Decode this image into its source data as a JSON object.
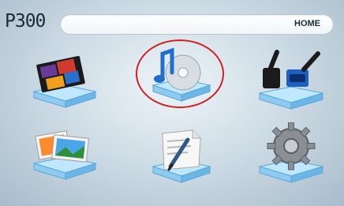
{
  "header": {
    "model": "P300",
    "location": "HOME"
  },
  "menu": {
    "items": [
      {
        "icon": "video-icon",
        "selected": false
      },
      {
        "icon": "music-icon",
        "selected": true
      },
      {
        "icon": "hdmi-vga-icon",
        "selected": false
      },
      {
        "icon": "photo-icon",
        "selected": false
      },
      {
        "icon": "document-icon",
        "selected": false
      },
      {
        "icon": "settings-gear-icon",
        "selected": false
      }
    ]
  },
  "colors": {
    "selection_ring": "#d02020",
    "background": "#cfdde6"
  }
}
